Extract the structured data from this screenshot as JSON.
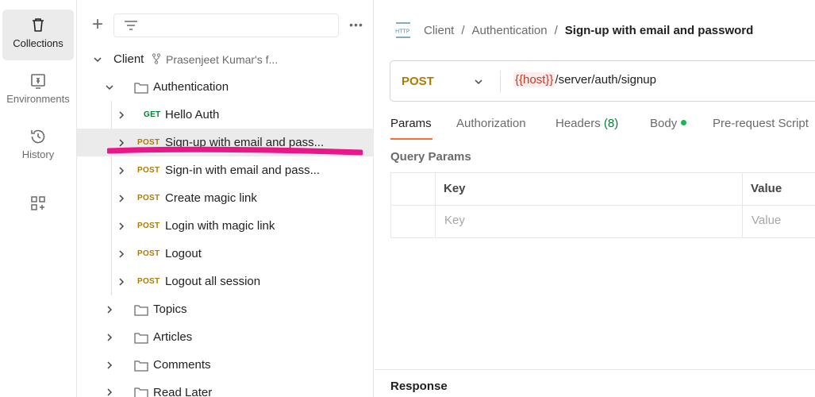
{
  "rail": {
    "items": [
      {
        "label": "Collections",
        "icon": "trash-bin-icon",
        "active": true
      },
      {
        "label": "Environments",
        "icon": "environment-icon",
        "active": false
      },
      {
        "label": "History",
        "icon": "history-icon",
        "active": false
      },
      {
        "label": "",
        "icon": "add-widget-icon",
        "active": false
      }
    ]
  },
  "sidebar": {
    "plus_label": "+",
    "more_label": "•••",
    "collection": {
      "name": "Client",
      "fork_owner": "Prasenjeet Kumar's f..."
    },
    "folders": {
      "authentication": "Authentication",
      "topics": "Topics",
      "articles": "Articles",
      "comments": "Comments",
      "read_later": "Read Later"
    },
    "requests": [
      {
        "method": "GET",
        "name": "Hello Auth"
      },
      {
        "method": "POST",
        "name": "Sign-up with email and pass..."
      },
      {
        "method": "POST",
        "name": "Sign-in with email and pass..."
      },
      {
        "method": "POST",
        "name": "Create magic link"
      },
      {
        "method": "POST",
        "name": "Login with magic link"
      },
      {
        "method": "POST",
        "name": "Logout"
      },
      {
        "method": "POST",
        "name": "Logout all session"
      }
    ],
    "selected_index": 1,
    "highlight_color": "#e8178a"
  },
  "breadcrumb": {
    "items": [
      "Client",
      "Authentication"
    ],
    "separator": "/",
    "current": "Sign-up with email and password"
  },
  "request": {
    "method": "POST",
    "url_variable": "{{host}}",
    "url_path": "/server/auth/signup"
  },
  "tabs": {
    "params": "Params",
    "authorization": "Authorization",
    "headers": "Headers",
    "headers_count": "(8)",
    "body": "Body",
    "prerequest": "Pre-request Script"
  },
  "query_params": {
    "section_label": "Query Params",
    "col_key": "Key",
    "col_value": "Value",
    "key_placeholder": "Key",
    "value_placeholder": "Value"
  },
  "response": {
    "label": "Response"
  },
  "colors": {
    "post": "#ad7a03",
    "get": "#007f31",
    "accent": "#ff6c37"
  }
}
